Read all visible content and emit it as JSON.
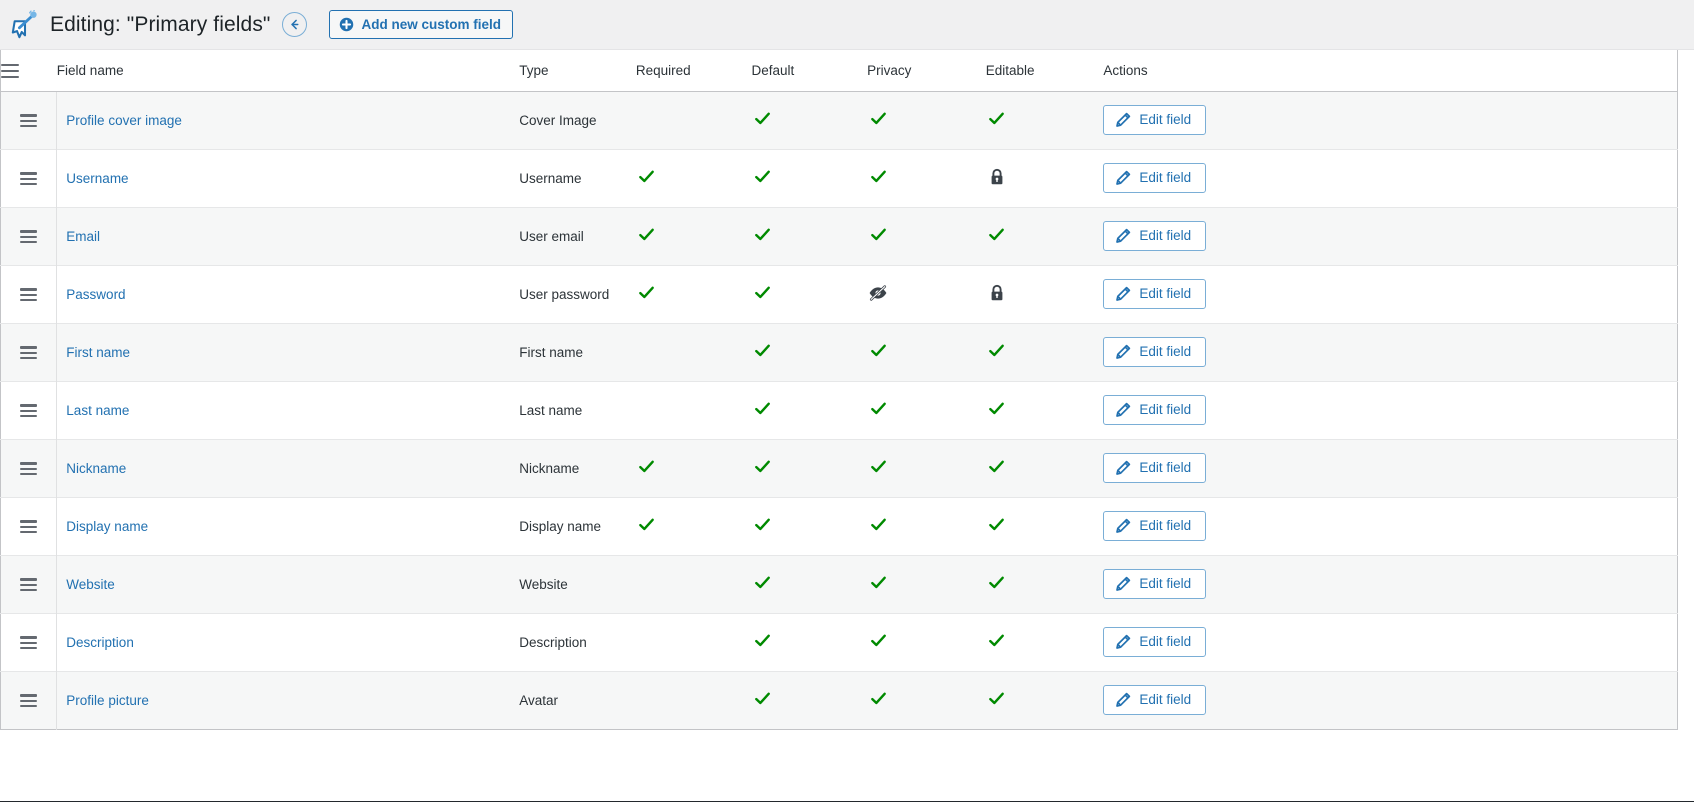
{
  "header": {
    "logo_icon": "magic-wand-cursor-logo",
    "title": "Editing: \"Primary fields\"",
    "back_icon": "arrow-left-icon",
    "back_label": "Back",
    "add_button": {
      "icon": "plus-circle-icon",
      "label": "Add new custom field"
    }
  },
  "table": {
    "handle_header_icon": "drag-handle-icon",
    "columns": [
      "Field name",
      "Type",
      "Required",
      "Default",
      "Privacy",
      "Editable",
      "Actions"
    ],
    "action_label": "Edit field",
    "action_icon": "pencil-icon",
    "icons": {
      "check": "check-icon",
      "lock": "lock-icon",
      "eye_slash": "eye-slash-icon"
    },
    "colors": {
      "check": "#008a00",
      "lock": "#3c434a",
      "link": "#2271b1",
      "accent": "#2271b1",
      "row_alt": "#f6f7f7",
      "header_bg": "#f0f0f1"
    },
    "rows": [
      {
        "name": "Profile cover image",
        "type": "Cover Image",
        "required": "",
        "default": "check",
        "privacy": "check",
        "editable": "check"
      },
      {
        "name": "Username",
        "type": "Username",
        "required": "check",
        "default": "check",
        "privacy": "check",
        "editable": "lock"
      },
      {
        "name": "Email",
        "type": "User email",
        "required": "check",
        "default": "check",
        "privacy": "check",
        "editable": "check"
      },
      {
        "name": "Password",
        "type": "User password",
        "required": "check",
        "default": "check",
        "privacy": "eye_slash",
        "editable": "lock"
      },
      {
        "name": "First name",
        "type": "First name",
        "required": "",
        "default": "check",
        "privacy": "check",
        "editable": "check"
      },
      {
        "name": "Last name",
        "type": "Last name",
        "required": "",
        "default": "check",
        "privacy": "check",
        "editable": "check"
      },
      {
        "name": "Nickname",
        "type": "Nickname",
        "required": "check",
        "default": "check",
        "privacy": "check",
        "editable": "check"
      },
      {
        "name": "Display name",
        "type": "Display name",
        "required": "check",
        "default": "check",
        "privacy": "check",
        "editable": "check"
      },
      {
        "name": "Website",
        "type": "Website",
        "required": "",
        "default": "check",
        "privacy": "check",
        "editable": "check"
      },
      {
        "name": "Description",
        "type": "Description",
        "required": "",
        "default": "check",
        "privacy": "check",
        "editable": "check"
      },
      {
        "name": "Profile picture",
        "type": "Avatar",
        "required": "",
        "default": "check",
        "privacy": "check",
        "editable": "check"
      }
    ]
  }
}
